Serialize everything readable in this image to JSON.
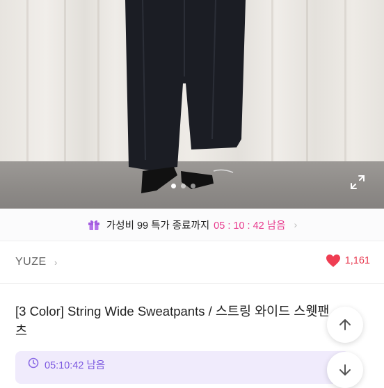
{
  "gallery": {
    "image_description_icon": "product-photo",
    "indicator_count": 3,
    "active_index": 0,
    "expand_icon": "expand-icon"
  },
  "promo": {
    "icon": "gift-icon",
    "label": "가성비 99 특가 종료까지",
    "timer": "05 : 10 : 42 남음",
    "chevron": "›"
  },
  "seller": {
    "name": "YUZE",
    "chevron": "›",
    "likes": "1,161"
  },
  "product": {
    "title": "[3 Color] String Wide Sweatpants / 스트링 와이드 스웻팬츠"
  },
  "countdown": {
    "text": "05:10:42 남음"
  },
  "colors": {
    "accent_pink": "#e8388c",
    "like_red": "#e8384f",
    "countdown_purple": "#7b57e0",
    "countdown_bg": "#f0ebfc"
  }
}
